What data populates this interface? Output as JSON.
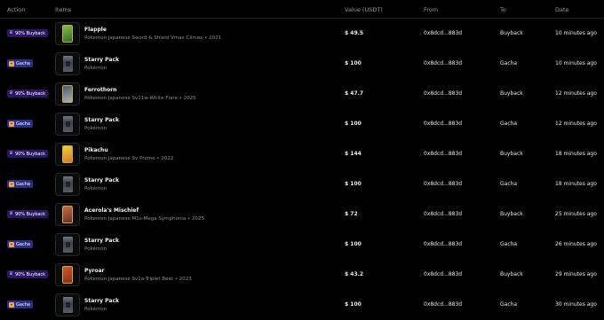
{
  "header": {
    "action": "Action",
    "items": "Items",
    "value": "Value (USDT)",
    "from": "From",
    "to": "To",
    "date": "Date"
  },
  "colors": {
    "buyback_badge": "#2b1763",
    "gacha_badge": "#2a2f86",
    "background": "#000000"
  },
  "rows": [
    {
      "action": "90% Buyback",
      "action_type": "buyback",
      "name": "Flapple",
      "sub": "Pokemon Japanese Sword & Shield Vmax Climax • 2021",
      "value": "$ 49.5",
      "from": "0x8dcd...883d",
      "to": "Buyback",
      "date": "10 minutes ago",
      "thumb": "card"
    },
    {
      "action": "Gacha",
      "action_type": "gacha",
      "name": "Starry Pack",
      "sub": "Pokémon",
      "value": "$ 100",
      "from": "0x8dcd...883d",
      "to": "Gacha",
      "date": "10 minutes ago",
      "thumb": "pack"
    },
    {
      "action": "90% Buyback",
      "action_type": "buyback",
      "name": "Ferrothorn",
      "sub": "Pokemon Japanese Sv11w-White Flare • 2025",
      "value": "$ 47.7",
      "from": "0x8dcd...883d",
      "to": "Buyback",
      "date": "12 minutes ago",
      "thumb": "card"
    },
    {
      "action": "Gacha",
      "action_type": "gacha",
      "name": "Starry Pack",
      "sub": "Pokémon",
      "value": "$ 100",
      "from": "0x8dcd...883d",
      "to": "Gacha",
      "date": "12 minutes ago",
      "thumb": "pack"
    },
    {
      "action": "90% Buyback",
      "action_type": "buyback",
      "name": "Pikachu",
      "sub": "Pokemon Japanese Sv Promo • 2022",
      "value": "$ 144",
      "from": "0x8dcd...883d",
      "to": "Buyback",
      "date": "18 minutes ago",
      "thumb": "card"
    },
    {
      "action": "Gacha",
      "action_type": "gacha",
      "name": "Starry Pack",
      "sub": "Pokémon",
      "value": "$ 100",
      "from": "0x8dcd...883d",
      "to": "Gacha",
      "date": "18 minutes ago",
      "thumb": "pack"
    },
    {
      "action": "90% Buyback",
      "action_type": "buyback",
      "name": "Acerola's Mischief",
      "sub": "Pokemon Japanese M1s-Mega Symphonia • 2025",
      "value": "$ 72",
      "from": "0x8dcd...883d",
      "to": "Buyback",
      "date": "25 minutes ago",
      "thumb": "card"
    },
    {
      "action": "Gacha",
      "action_type": "gacha",
      "name": "Starry Pack",
      "sub": "Pokémon",
      "value": "$ 100",
      "from": "0x8dcd...883d",
      "to": "Gacha",
      "date": "26 minutes ago",
      "thumb": "pack"
    },
    {
      "action": "90% Buyback",
      "action_type": "buyback",
      "name": "Pyroar",
      "sub": "Pokemon Japanese Sv1a-Triplet Beat • 2023",
      "value": "$ 43.2",
      "from": "0x8dcd...883d",
      "to": "Buyback",
      "date": "29 minutes ago",
      "thumb": "card"
    },
    {
      "action": "Gacha",
      "action_type": "gacha",
      "name": "Starry Pack",
      "sub": "Pokémon",
      "value": "$ 100",
      "from": "0x8dcd...883d",
      "to": "Gacha",
      "date": "30 minutes ago",
      "thumb": "pack"
    }
  ]
}
